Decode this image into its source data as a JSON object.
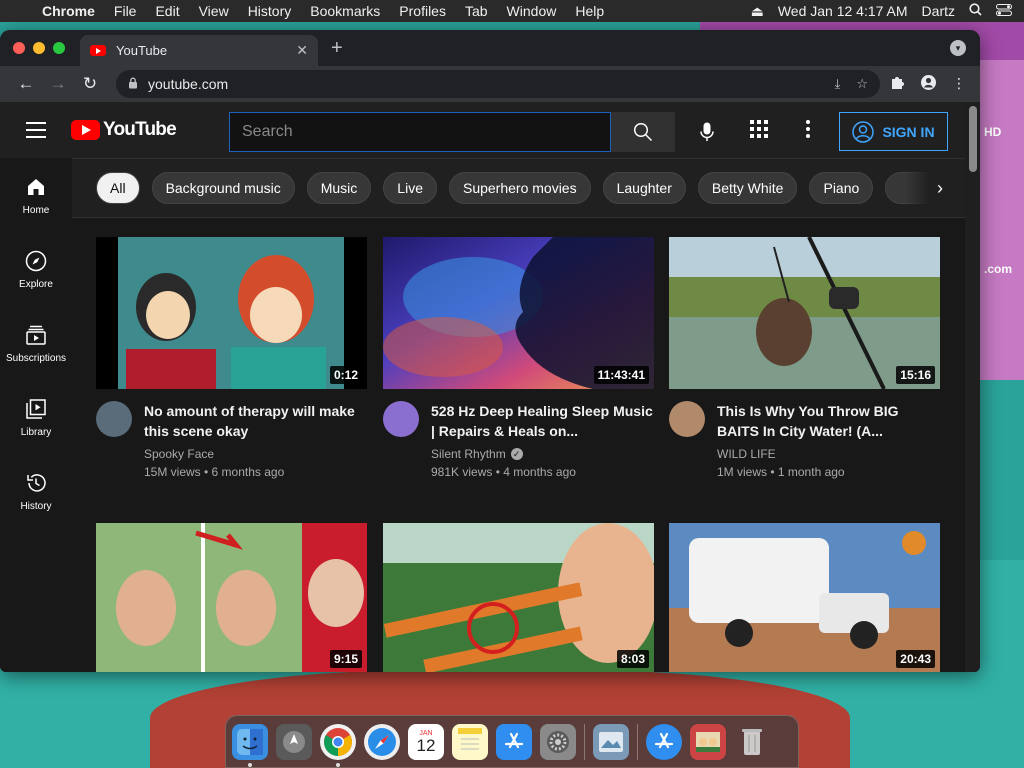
{
  "menubar": {
    "app": "Chrome",
    "items": [
      "File",
      "Edit",
      "View",
      "History",
      "Bookmarks",
      "Profiles",
      "Tab",
      "Window",
      "Help"
    ],
    "datetime": "Wed Jan 12  4:17 AM",
    "user": "Dartz"
  },
  "browser": {
    "tab_title": "YouTube",
    "url": "youtube.com"
  },
  "desktop": {
    "partial_text_1": "HD",
    "partial_text_2": ".com"
  },
  "youtube": {
    "logo_text": "YouTube",
    "search_placeholder": "Search",
    "signin_label": "SIGN IN",
    "sidebar": [
      {
        "label": "Home",
        "icon": "home-icon"
      },
      {
        "label": "Explore",
        "icon": "compass-icon"
      },
      {
        "label": "Subscriptions",
        "icon": "subscriptions-icon"
      },
      {
        "label": "Library",
        "icon": "library-icon"
      },
      {
        "label": "History",
        "icon": "history-icon"
      }
    ],
    "chips": [
      "All",
      "Background music",
      "Music",
      "Live",
      "Superhero movies",
      "Laughter",
      "Betty White",
      "Piano"
    ],
    "videos": [
      {
        "title": "No amount of therapy will make this scene okay",
        "channel": "Spooky Face",
        "verified": false,
        "stats": "15M views • 6 months ago",
        "duration": "0:12",
        "thumb_color": "#3d7d86",
        "avatar_color": "#5a6b7a"
      },
      {
        "title": "528 Hz Deep Healing Sleep Music | Repairs & Heals on...",
        "channel": "Silent Rhythm",
        "verified": true,
        "stats": "981K views • 4 months ago",
        "duration": "11:43:41",
        "thumb_color": "#3b2a8f",
        "avatar_color": "#8a6fd0"
      },
      {
        "title": "This Is Why You Throw BIG BAITS In City Water! (A...",
        "channel": "WILD LIFE",
        "verified": false,
        "stats": "1M views • 1 month ago",
        "duration": "15:16",
        "thumb_color": "#7a8a5a",
        "avatar_color": "#b08a6a"
      },
      {
        "title": "",
        "channel": "",
        "verified": false,
        "stats": "",
        "duration": "9:15",
        "thumb_color": "#7fb06a",
        "avatar_color": ""
      },
      {
        "title": "",
        "channel": "",
        "verified": false,
        "stats": "",
        "duration": "8:03",
        "thumb_color": "#3d7a3a",
        "avatar_color": ""
      },
      {
        "title": "",
        "channel": "",
        "verified": false,
        "stats": "",
        "duration": "20:43",
        "thumb_color": "#5b8bc0",
        "avatar_color": ""
      }
    ]
  },
  "dock": {
    "icons": [
      "finder-icon",
      "launchpad-icon",
      "chrome-icon",
      "safari-icon",
      "calendar-icon",
      "notes-icon",
      "app-store-icon",
      "system-preferences-icon",
      "preview-icon",
      "app-store-folder-icon",
      "photo-booth-icon",
      "trash-icon"
    ],
    "calendar_month": "JAN",
    "calendar_day": "12"
  }
}
